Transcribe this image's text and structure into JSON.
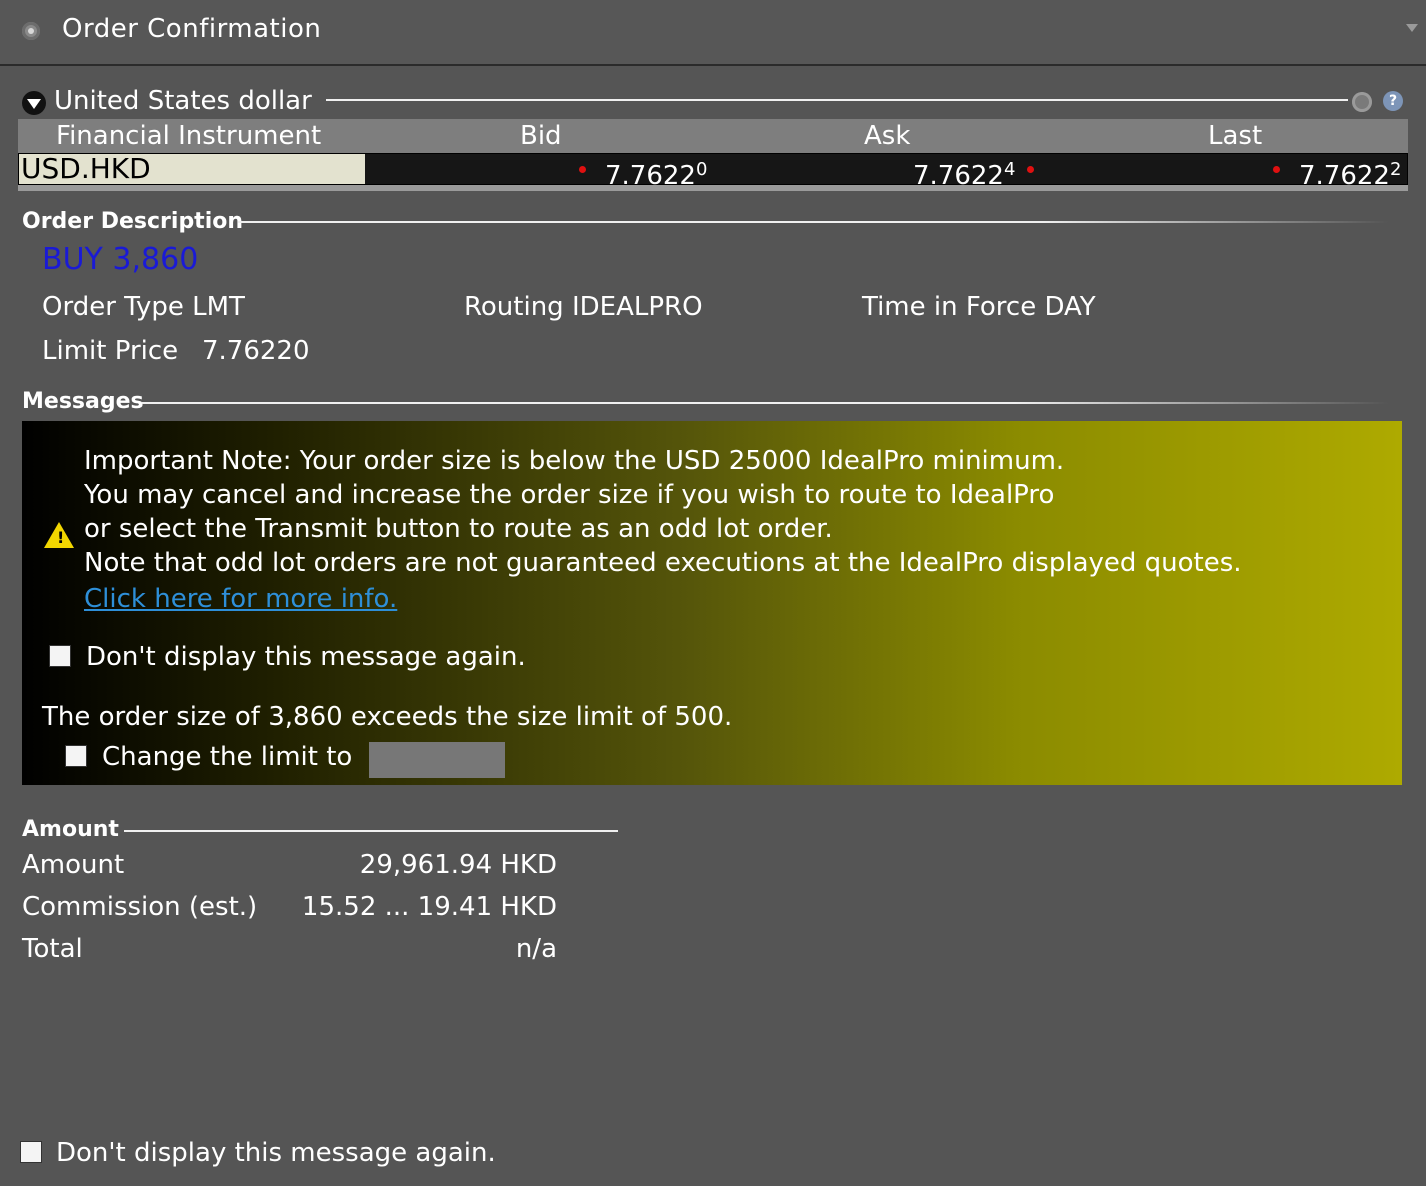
{
  "window": {
    "title": "Order Confirmation"
  },
  "instrument_section": {
    "title": "United States dollar",
    "columns": [
      "Financial Instrument",
      "Bid",
      "Ask",
      "Last"
    ],
    "row": {
      "symbol": "USD.HKD",
      "bid_main": "7.7622",
      "bid_sup": "0",
      "ask_main": "7.7622",
      "ask_sup": "4",
      "last_main": "7.7622",
      "last_sup": "2"
    }
  },
  "order_description": {
    "header": "Order Description",
    "action": "BUY 3,860",
    "order_type": "Order Type LMT",
    "routing": "Routing IDEALPRO",
    "time_in_force": "Time in Force DAY",
    "limit_price_label": "Limit Price",
    "limit_price_value": "7.76220"
  },
  "messages": {
    "header": "Messages",
    "lines": [
      "Important Note: Your order size is below the USD 25000 IdealPro minimum.",
      "You may cancel and increase the order size if you wish to route to IdealPro",
      "or select the Transmit button to route as an odd lot order.",
      "Note that odd lot orders are not guaranteed executions at the IdealPro displayed quotes."
    ],
    "link": "Click here for more info.",
    "dont_display": "Don't display this message again.",
    "size_limit": "The order size of 3,860 exceeds the size limit of 500.",
    "change_limit": "Change the limit to",
    "limit_input_value": ""
  },
  "amount": {
    "header": "Amount",
    "amount_label": "Amount",
    "amount_value": "29,961.94 HKD",
    "commission_label": "Commission (est.)",
    "commission_value": "15.52 ... 19.41 HKD",
    "total_label": "Total",
    "total_value": "n/a"
  },
  "footer": {
    "dont_display": "Don't display this message again."
  },
  "colors": {
    "background": "#555555",
    "buy": "#1a1ad6",
    "link": "#2e8fd8",
    "warning": "#f2d600",
    "tick_dot": "#e01010"
  }
}
